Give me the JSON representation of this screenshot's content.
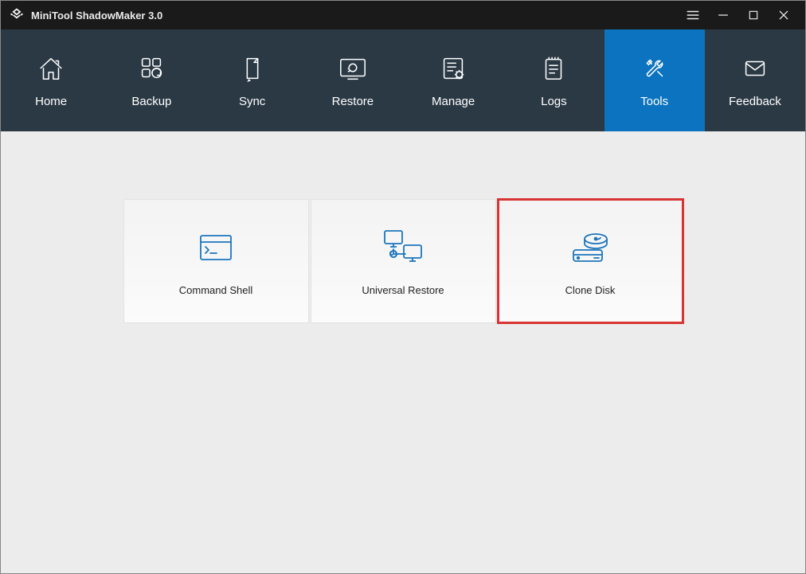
{
  "app": {
    "title": "MiniTool ShadowMaker 3.0"
  },
  "nav": {
    "home": "Home",
    "backup": "Backup",
    "sync": "Sync",
    "restore": "Restore",
    "manage": "Manage",
    "logs": "Logs",
    "tools": "Tools",
    "feedback": "Feedback",
    "active": "tools"
  },
  "tools": {
    "command_shell": "Command Shell",
    "universal_restore": "Universal Restore",
    "clone_disk": "Clone Disk",
    "highlighted": "clone_disk"
  },
  "colors": {
    "titlebar_bg": "#1a1a1a",
    "navbar_bg": "#2b3945",
    "accent": "#0b73bf",
    "content_bg": "#ececec",
    "tile_icon": "#1c75bc",
    "highlight_border": "#d83434"
  }
}
